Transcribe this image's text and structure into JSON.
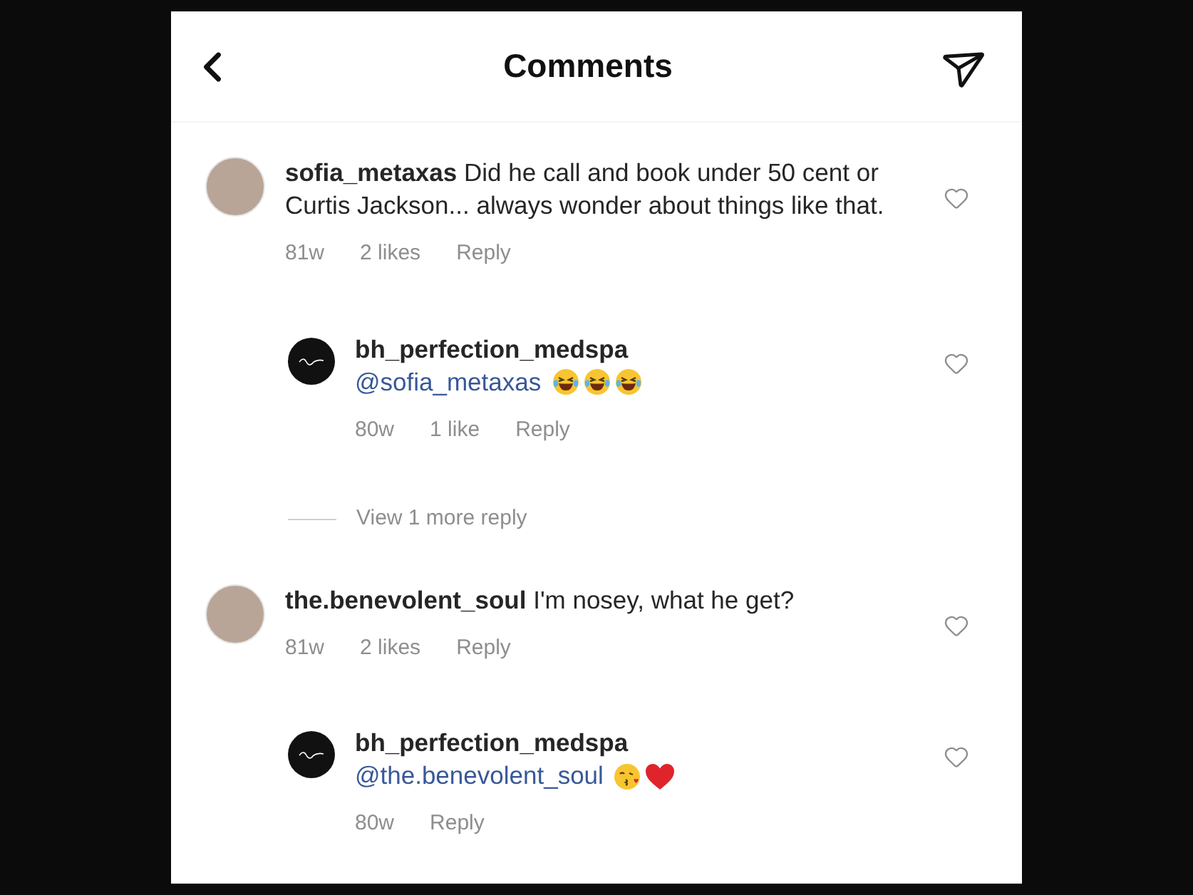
{
  "header": {
    "title": "Comments"
  },
  "comments": [
    {
      "username": "sofia_metaxas",
      "text": "Did he call and book under 50 cent or Curtis Jackson... always wonder about things like that.",
      "age": "81w",
      "likes": "2 likes",
      "reply": "Reply",
      "liked": false,
      "more_replies": "View 1 more reply",
      "replies": [
        {
          "username": "bh_perfection_medspa",
          "mention": "@sofia_metaxas",
          "emoji": [
            {
              "kind": "laughing"
            },
            {
              "kind": "laughing"
            },
            {
              "kind": "laughing"
            }
          ],
          "age": "80w",
          "likes": "1 like",
          "reply": "Reply",
          "liked": false
        }
      ]
    },
    {
      "username": "the.benevolent_soul",
      "text": "I'm nosey, what he get?",
      "age": "81w",
      "likes": "2 likes",
      "reply": "Reply",
      "liked": false,
      "replies": [
        {
          "username": "bh_perfection_medspa",
          "mention": "@the.benevolent_soul",
          "emoji": [
            {
              "kind": "kissing"
            },
            {
              "kind": "heart"
            }
          ],
          "age": "80w",
          "reply": "Reply",
          "liked": false
        }
      ]
    }
  ]
}
